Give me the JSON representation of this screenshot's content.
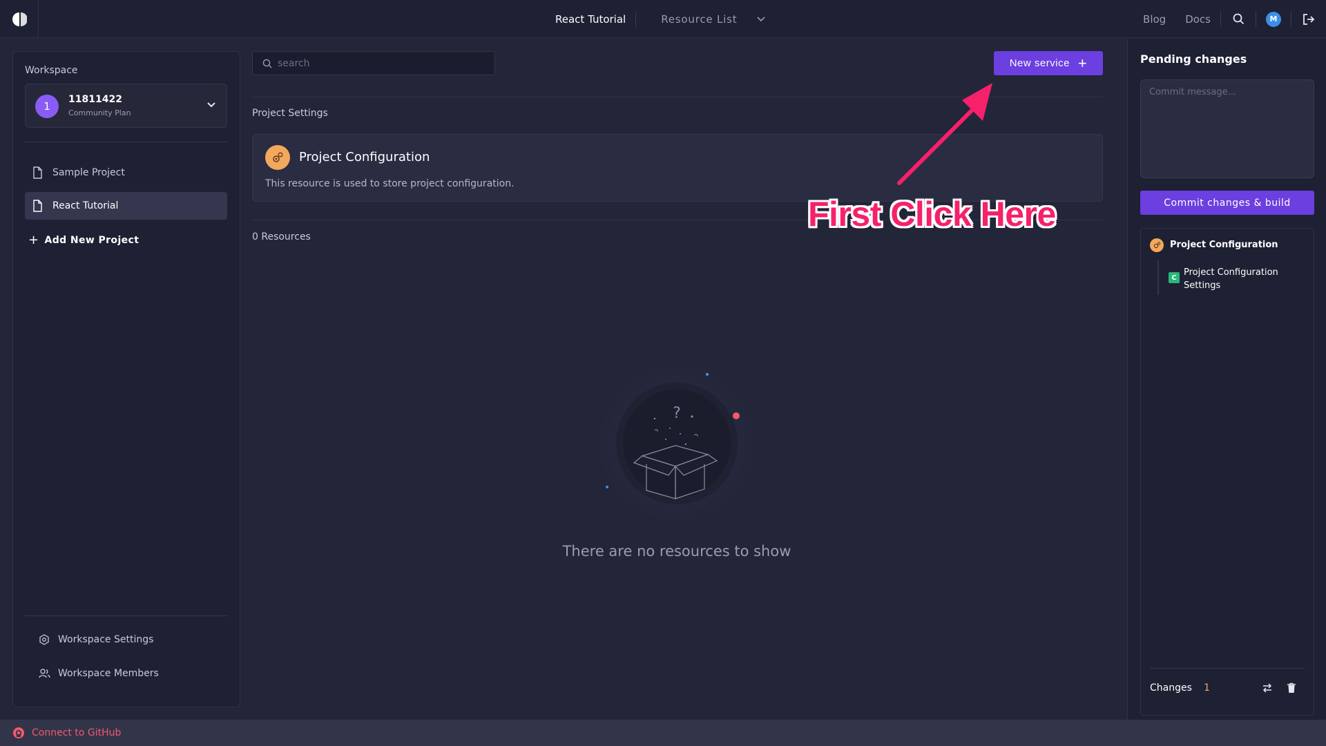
{
  "header": {
    "active_tab": "React Tutorial",
    "resource_list": "Resource List",
    "blog": "Blog",
    "docs": "Docs",
    "user_initial": "M"
  },
  "sidebar": {
    "workspace_label": "Workspace",
    "workspace": {
      "initial": "1",
      "name": "11811422",
      "plan": "Community Plan"
    },
    "projects": [
      {
        "label": "Sample Project",
        "active": false
      },
      {
        "label": "React Tutorial",
        "active": true
      }
    ],
    "add_project": "Add New Project",
    "workspace_settings": "Workspace Settings",
    "workspace_members": "Workspace Members"
  },
  "main": {
    "search_placeholder": "search",
    "new_service_label": "New service",
    "section_title": "Project Settings",
    "config_card": {
      "title": "Project Configuration",
      "description": "This resource is used to store project configuration."
    },
    "resource_count": "0 Resources",
    "empty_text": "There are no resources to show"
  },
  "annotation": {
    "text": "First Click Here",
    "color": "#f5216a"
  },
  "pending": {
    "title": "Pending changes",
    "commit_placeholder": "Commit message...",
    "commit_button": "Commit changes & build",
    "change_item": "Project Configuration",
    "change_sub_badge": "C",
    "change_sub_label": "Project Configuration Settings",
    "changes_label": "Changes",
    "changes_count": "1"
  },
  "footer": {
    "github_label": "Connect to GitHub"
  },
  "colors": {
    "accent": "#6b3fe0",
    "background": "#232538",
    "panel": "#1e2033",
    "config_icon": "#f4a85c",
    "github": "#f25a6e"
  }
}
